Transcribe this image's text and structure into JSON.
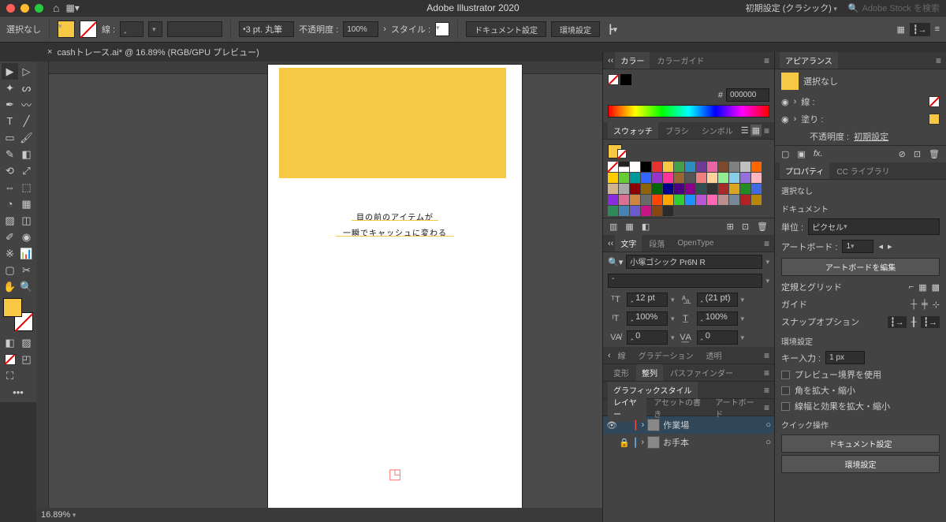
{
  "app": {
    "title": "Adobe Illustrator 2020",
    "workspace": "初期設定 (クラシック)",
    "stock_placeholder": "Adobe Stock を検索"
  },
  "control": {
    "no_selection": "選択なし",
    "stroke_label": "線 :",
    "brush_value": "3 pt. 丸筆",
    "opacity_label": "不透明度 :",
    "opacity_value": "100%",
    "style_label": "スタイル :",
    "doc_setup": "ドキュメント設定",
    "prefs": "環境設定"
  },
  "tab": {
    "close": "×",
    "name": "cashトレース.ai* @ 16.89% (RGB/GPU プレビュー)"
  },
  "artboard": {
    "line1": "目の前のアイテムが",
    "line2": "一瞬でキャッシュに変わる"
  },
  "color": {
    "tab1": "カラー",
    "tab2": "カラーガイド",
    "hash": "#",
    "hex": "000000"
  },
  "swatches": {
    "tab1": "スウォッチ",
    "tab2": "ブラシ",
    "tab3": "シンボル"
  },
  "char": {
    "tab1": "文字",
    "tab2": "段落",
    "tab3": "OpenType",
    "font": "小塚ゴシック Pr6N R",
    "weight": "-",
    "size": "12 pt",
    "leading": "(21 pt)",
    "vscale": "100%",
    "hscale": "100%",
    "kerning": "0",
    "tracking": "0"
  },
  "grad": {
    "tab1": "線",
    "tab2": "グラデーション",
    "tab3": "透明"
  },
  "transform": {
    "tab1": "変形",
    "tab2": "整列",
    "tab3": "パスファインダー"
  },
  "gstyle": {
    "tab1": "グラフィックスタイル"
  },
  "layers": {
    "tab1": "レイヤー",
    "tab2": "アセットの書き",
    "tab3": "アートボード",
    "layer1": "作業場",
    "layer2": "お手本"
  },
  "appearance": {
    "title": "アピアランス",
    "no_selection": "選択なし",
    "stroke": "線 :",
    "fill": "塗り :",
    "opacity_label": "不透明度 :",
    "opacity_value": "初期設定"
  },
  "properties": {
    "tab1": "プロパティ",
    "tab2": "CC ライブラリ",
    "no_selection": "選択なし",
    "doc_title": "ドキュメント",
    "unit_label": "単位 :",
    "unit_value": "ピクセル",
    "artboard_label": "アートボード :",
    "artboard_value": "1",
    "edit_artboard": "アートボードを編集",
    "ruler_title": "定規とグリッド",
    "guide_title": "ガイド",
    "snap_title": "スナップオプション",
    "prefs_title": "環境設定",
    "key_input_label": "キー入力 :",
    "key_input_value": "1 px",
    "chk1": "プレビュー境界を使用",
    "chk2": "角を拡大・縮小",
    "chk3": "線幅と効果を拡大・縮小",
    "quick_title": "クイック操作",
    "doc_setup_btn": "ドキュメント設定",
    "prefs_btn": "環境設定"
  },
  "status": {
    "zoom": "16.89%"
  },
  "swatch_colors": [
    "#ffffff",
    "#000000",
    "#e6312e",
    "#f6c844",
    "#46a048",
    "#2e8cc0",
    "#6d3a98",
    "#e964a4",
    "#7a4a2a",
    "#808080",
    "#c0c0c0",
    "#ff6600",
    "#ffcc00",
    "#66cc33",
    "#009999",
    "#3366ff",
    "#9933cc",
    "#ff3399",
    "#996633",
    "#555555",
    "#f08080",
    "#ffd39b",
    "#90ee90",
    "#87ceeb",
    "#9370db",
    "#ffb6c1",
    "#d2b48c",
    "#a9a9a9",
    "#8b0000",
    "#8b6508",
    "#006400",
    "#00008b",
    "#4b0082",
    "#8b008b",
    "#2f4f4f",
    "#333333",
    "#a52a2a",
    "#daa520",
    "#228b22",
    "#4169e1",
    "#8a2be2",
    "#db7093",
    "#cd853f",
    "#696969",
    "#ff4500",
    "#ffa500",
    "#32cd32",
    "#1e90ff",
    "#ba55d3",
    "#ff69b4",
    "#bc8f8f",
    "#778899",
    "#b22222",
    "#b8860b",
    "#2e8b57",
    "#4682b4",
    "#6a5acd",
    "#c71585",
    "#8b4513",
    "#2b2b2b"
  ]
}
